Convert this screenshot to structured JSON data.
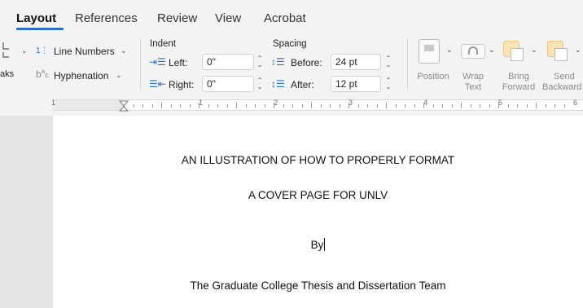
{
  "tabs": [
    "Layout",
    "References",
    "Review",
    "View",
    "Acrobat"
  ],
  "ribbon": {
    "left_group": {
      "breaks_label": "aks",
      "line_numbers_label": "Line Numbers",
      "hyphenation_label": "Hyphenation"
    },
    "indent": {
      "title": "Indent",
      "left_label": "Left:",
      "left_value": "0\"",
      "right_label": "Right:",
      "right_value": "0\""
    },
    "spacing": {
      "title": "Spacing",
      "before_label": "Before:",
      "before_value": "24 pt",
      "after_label": "After:",
      "after_value": "12 pt"
    },
    "arrange": {
      "position_label": "Position",
      "wrap_text_label_1": "Wrap",
      "wrap_text_label_2": "Text",
      "bring_forward_label_1": "Bring",
      "bring_forward_label_2": "Forward",
      "send_backward_label_1": "Send",
      "send_backward_label_2": "Backward"
    }
  },
  "ruler": {
    "numbers": [
      "1",
      "1",
      "2",
      "3",
      "4",
      "5",
      "6"
    ]
  },
  "document": {
    "title_line_1": "AN ILLUSTRATION OF HOW TO PROPERLY FORMAT",
    "title_line_2": "A COVER PAGE FOR UNLV",
    "by": "By",
    "author": "The Graduate College Thesis and Dissertation Team"
  },
  "colors": {
    "accent": "#2b6fc9",
    "ribbon_bg": "#f3f3f3",
    "page_bg": "#ffffff"
  }
}
